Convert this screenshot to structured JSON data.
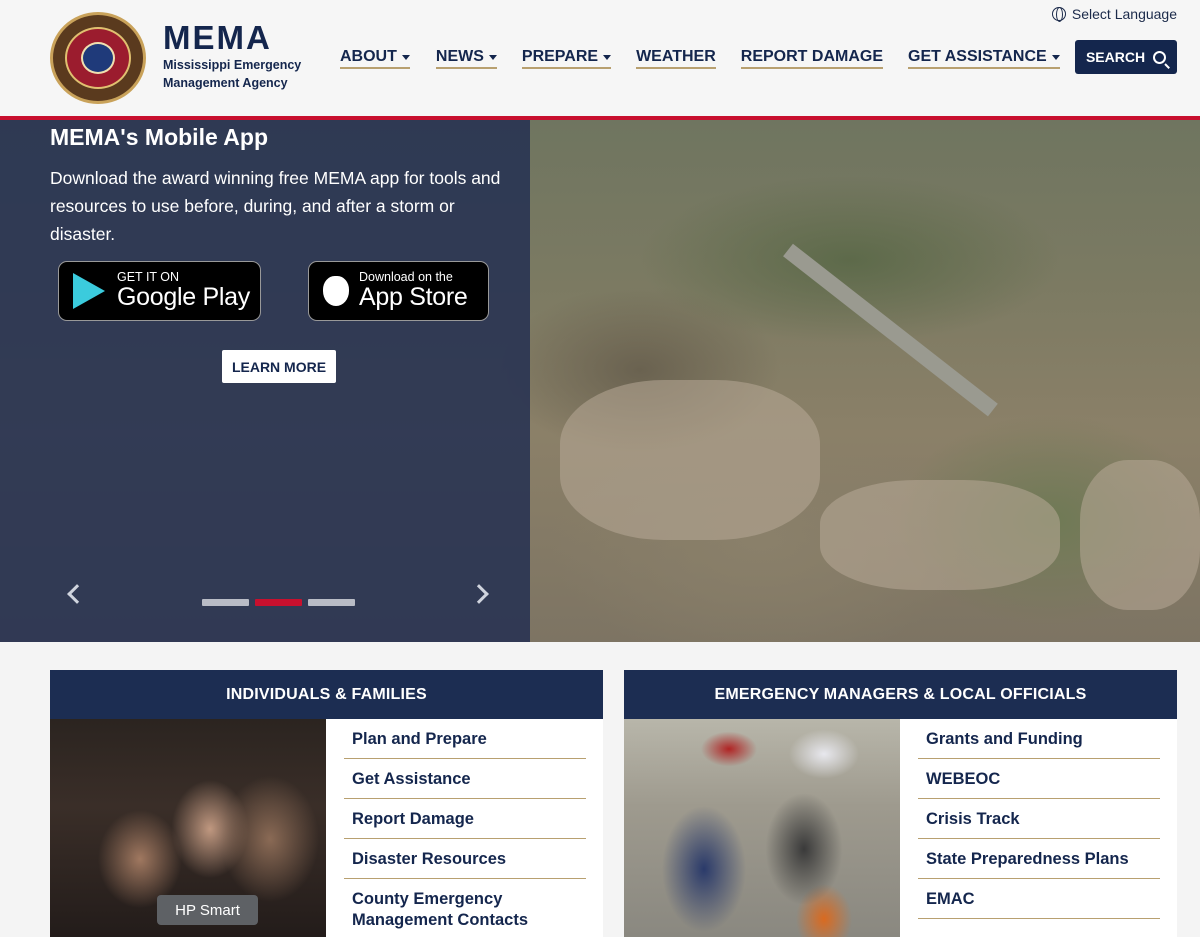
{
  "header": {
    "brand_name": "MEMA",
    "brand_sub": "Mississippi Emergency Management Agency",
    "language": "Select Language",
    "nav": [
      {
        "label": "ABOUT",
        "dropdown": true
      },
      {
        "label": "NEWS",
        "dropdown": true
      },
      {
        "label": "PREPARE",
        "dropdown": true
      },
      {
        "label": "WEATHER",
        "dropdown": false
      },
      {
        "label": "REPORT DAMAGE",
        "dropdown": false
      },
      {
        "label": "GET ASSISTANCE",
        "dropdown": true
      }
    ],
    "search_label": "SEARCH"
  },
  "hero": {
    "title": "MEMA's Mobile App",
    "text": "Download the award winning free MEMA app for tools and resources to use before, during, and after a storm or disaster.",
    "google_small": "GET IT ON",
    "google_big": "Google Play",
    "apple_small": "Download on the",
    "apple_big": "App Store",
    "learn_more": "LEARN MORE",
    "slide_count": 3,
    "active_slide": 2
  },
  "cards": {
    "left": {
      "title": "INDIVIDUALS & FAMILIES",
      "tooltip": "HP Smart",
      "links": [
        "Plan and Prepare",
        "Get Assistance",
        "Report Damage",
        "Disaster Resources",
        "County Emergency Management Contacts"
      ]
    },
    "right": {
      "title": "EMERGENCY MANAGERS & LOCAL OFFICIALS",
      "links": [
        "Grants and Funding",
        "WEBEOC",
        "Crisis Track",
        "State Preparedness Plans",
        "EMAC"
      ]
    }
  },
  "colors": {
    "navy": "#14264d",
    "accent_red": "#c8102e",
    "underline_gold": "#b8a070"
  }
}
